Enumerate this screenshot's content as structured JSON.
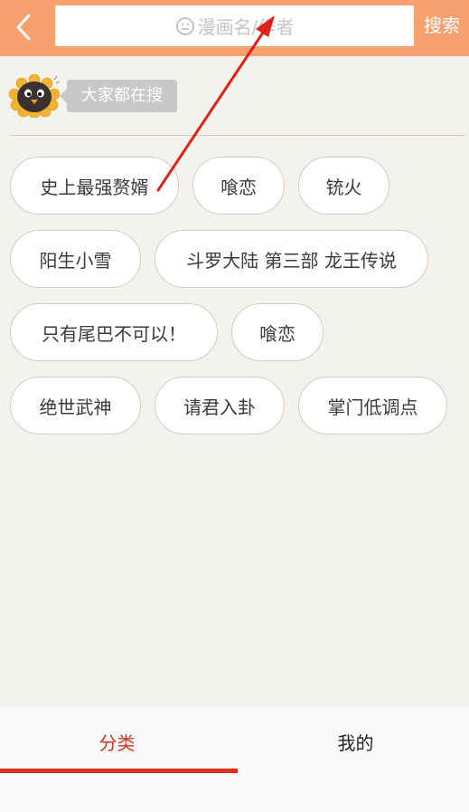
{
  "header": {
    "search_placeholder": "漫画名/作者",
    "search_button": "搜索"
  },
  "hot": {
    "title": "大家都在搜",
    "tags": [
      "史上最强赘婿",
      "喰恋",
      "铳火",
      "阳生小雪",
      "斗罗大陆 第三部 龙王传说",
      "只有尾巴不可以！",
      "喰恋",
      "绝世武神",
      "请君入卦",
      "掌门低调点"
    ]
  },
  "nav": {
    "tabs": [
      {
        "label": "分类",
        "active": true
      },
      {
        "label": "我的",
        "active": false
      }
    ]
  },
  "colors": {
    "header_bg": "#f8a070",
    "accent": "#d9301f",
    "annotation_arrow": "#e0201c"
  },
  "icons": [
    "back-arrow-icon",
    "search-smiley-icon",
    "mascot-icon"
  ]
}
